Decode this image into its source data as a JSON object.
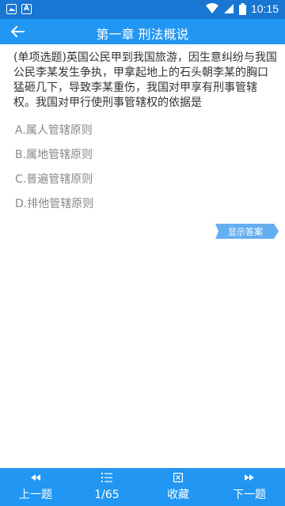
{
  "status_bar": {
    "time": "10:15",
    "left_icons": [
      "image-icon",
      "a-icon"
    ],
    "right_icons": [
      "wifi-icon",
      "signal-icon",
      "battery-icon"
    ]
  },
  "app_bar": {
    "title": "第一章 刑法概说",
    "back_icon": "arrow-left-icon"
  },
  "question": {
    "text": "(单项选题)英国公民甲到我国旅游，因生意纠纷与我国公民李某发生争执，甲拿起地上的石头朝李某的胸口猛砸几下，导致李某重伤，我国对甲享有刑事管辖权。我国对甲行使刑事管辖权的依据是"
  },
  "options": [
    {
      "label": "A.属人管辖原则"
    },
    {
      "label": "B.属地管辖原则"
    },
    {
      "label": "C.普遍管辖原则"
    },
    {
      "label": "D.排他管辖原则"
    }
  ],
  "show_answer": {
    "label": "显示答案"
  },
  "bottom_nav": {
    "prev": {
      "label": "上一题",
      "icon": "double-left-arrow-icon"
    },
    "progress": {
      "label": "1/65",
      "icon": "list-icon"
    },
    "favorite": {
      "label": "收藏",
      "icon": "boxed-x-icon"
    },
    "next": {
      "label": "下一题",
      "icon": "double-right-arrow-icon"
    }
  },
  "colors": {
    "status_bar": "#1976d2",
    "app_bar": "#2196f3",
    "option_text": "#888888",
    "question_text": "#333333",
    "answer_tag": "#64aef2"
  }
}
